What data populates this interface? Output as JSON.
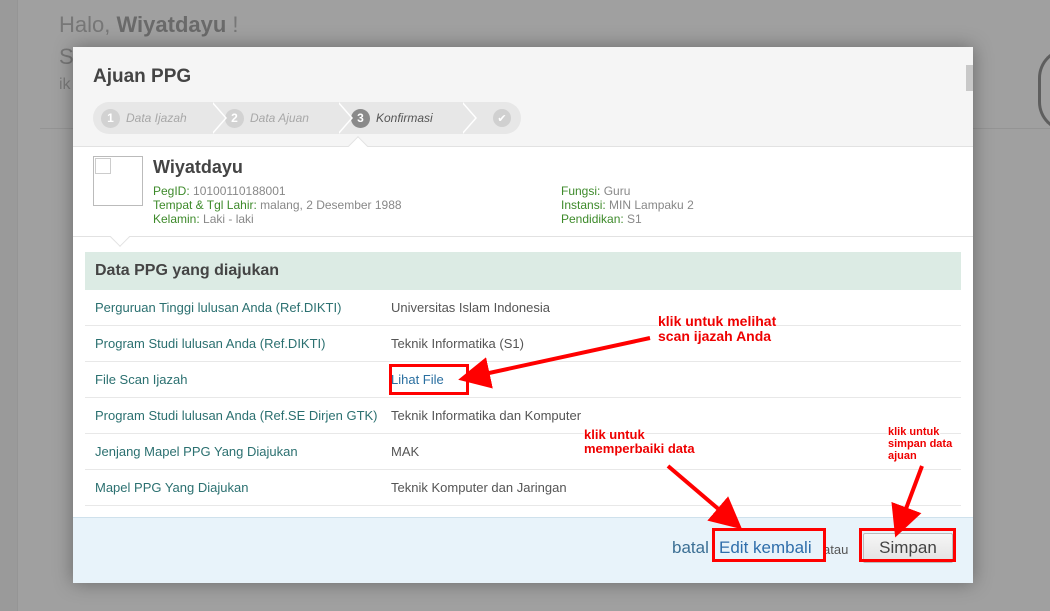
{
  "background": {
    "greeting_prefix": "Halo, ",
    "greeting_name": "Wiyatdayu",
    "greeting_suffix": " !",
    "line2_fragment": "S",
    "line3_fragment": "ik"
  },
  "modal": {
    "title": "Ajuan PPG",
    "steps": [
      {
        "num": "1",
        "label": "Data Ijazah"
      },
      {
        "num": "2",
        "label": "Data Ajuan"
      },
      {
        "num": "3",
        "label": "Konfirmasi"
      },
      {
        "num": "",
        "label": "✔"
      }
    ],
    "active_step": 3
  },
  "profile": {
    "name": "Wiyatdayu",
    "left": [
      {
        "key": "PegID:",
        "value": " 10100110188001"
      },
      {
        "key": "Tempat & Tgl Lahir:",
        "value": " malang, 2 Desember 1988"
      },
      {
        "key": "Kelamin:",
        "value": " Laki - laki"
      }
    ],
    "right": [
      {
        "key": "Fungsi:",
        "value": " Guru"
      },
      {
        "key": "Instansi:",
        "value": " MIN Lampaku 2"
      },
      {
        "key": "Pendidikan:",
        "value": " S1"
      }
    ]
  },
  "section": {
    "title": "Data PPG yang diajukan",
    "rows": [
      {
        "label": "Perguruan Tinggi lulusan Anda (Ref.DIKTI)",
        "value": "Universitas Islam Indonesia"
      },
      {
        "label": "Program Studi lulusan Anda (Ref.DIKTI)",
        "value": "Teknik Informatika (S1)"
      },
      {
        "label": "File Scan Ijazah",
        "value": "Lihat File"
      },
      {
        "label": "Program Studi lulusan Anda (Ref.SE Dirjen GTK)",
        "value": "Teknik Informatika dan Komputer"
      },
      {
        "label": "Jenjang Mapel PPG Yang Diajukan",
        "value": "MAK"
      },
      {
        "label": "Mapel PPG Yang Diajukan",
        "value": "Teknik Komputer dan Jaringan"
      }
    ]
  },
  "footer": {
    "batal": "batal",
    "edit": "Edit kembali",
    "atau": "atau",
    "simpan": "Simpan"
  },
  "annotations": {
    "lihat_file_line1": "klik untuk melihat",
    "lihat_file_line2": "scan ijazah Anda",
    "edit_line1": "klik untuk",
    "edit_line2": "memperbaiki data",
    "simpan_line1": "klik untuk",
    "simpan_line2": "simpan data",
    "simpan_line3": "ajuan",
    "color": "#ff0000"
  }
}
